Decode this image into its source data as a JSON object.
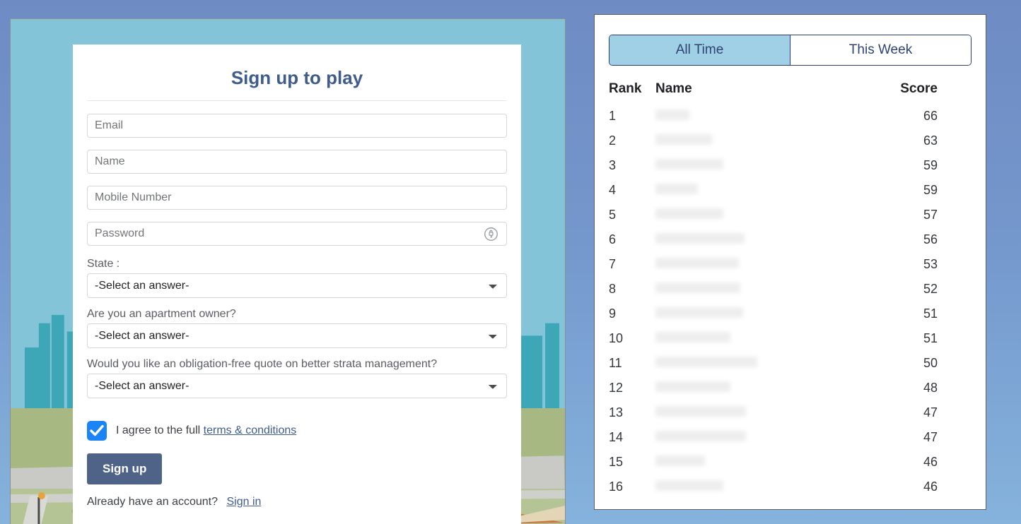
{
  "signup": {
    "title": "Sign up to play",
    "fields": [
      {
        "name": "email",
        "placeholder": "Email",
        "value": "",
        "type": "email"
      },
      {
        "name": "name",
        "placeholder": "Name",
        "value": "",
        "type": "text"
      },
      {
        "name": "mobile",
        "placeholder": "Mobile Number",
        "value": "",
        "type": "tel"
      },
      {
        "name": "password",
        "placeholder": "Password",
        "value": "",
        "type": "password"
      }
    ],
    "password_icon": "key-lock-icon",
    "questions": [
      {
        "label": "State :",
        "selected": "-Select an answer-"
      },
      {
        "label": "Are you an apartment owner?",
        "selected": "-Select an answer-"
      },
      {
        "label": "Would you like an obligation-free quote on better strata management?",
        "selected": "-Select an answer-"
      }
    ],
    "terms": {
      "checked": true,
      "text": "I agree to the full",
      "link_label": "terms & conditions"
    },
    "submit_label": "Sign up",
    "footer": {
      "text": "Already have an account?",
      "link_label": "Sign in"
    }
  },
  "leaderboard": {
    "tabs": [
      {
        "label": "All Time",
        "active": true
      },
      {
        "label": "This Week",
        "active": false
      }
    ],
    "columns": [
      "Rank",
      "Name",
      "Score"
    ],
    "rows": [
      {
        "rank": "1",
        "name": "",
        "name_width": 48,
        "score": "66"
      },
      {
        "rank": "2",
        "name": "",
        "name_width": 80,
        "score": "63"
      },
      {
        "rank": "3",
        "name": "",
        "name_width": 96,
        "score": "59"
      },
      {
        "rank": "4",
        "name": "",
        "name_width": 60,
        "score": "59"
      },
      {
        "rank": "5",
        "name": "",
        "name_width": 96,
        "score": "57"
      },
      {
        "rank": "6",
        "name": "",
        "name_width": 126,
        "score": "56"
      },
      {
        "rank": "7",
        "name": "",
        "name_width": 118,
        "score": "53"
      },
      {
        "rank": "8",
        "name": "",
        "name_width": 120,
        "score": "52"
      },
      {
        "rank": "9",
        "name": "",
        "name_width": 124,
        "score": "51"
      },
      {
        "rank": "10",
        "name": "",
        "name_width": 106,
        "score": "51"
      },
      {
        "rank": "11",
        "name": "",
        "name_width": 144,
        "score": "50"
      },
      {
        "rank": "12",
        "name": "",
        "name_width": 106,
        "score": "48"
      },
      {
        "rank": "13",
        "name": "",
        "name_width": 128,
        "score": "47"
      },
      {
        "rank": "14",
        "name": "",
        "name_width": 128,
        "score": "47"
      },
      {
        "rank": "15",
        "name": "",
        "name_width": 70,
        "score": "46"
      },
      {
        "rank": "16",
        "name": "",
        "name_width": 96,
        "score": "46"
      }
    ]
  },
  "theme": {
    "page_bg_top": "#6f8bc4",
    "page_bg_bottom": "#85b3dc",
    "title_color": "#3f5c8c",
    "button_bg": "#4f6389",
    "checkbox_bg": "#1b84f7",
    "tab_active_bg": "#9fd0e6",
    "tab_border": "#2a3a7a",
    "sky_color": "#84c4d8",
    "skyline_color": "#3da7b8",
    "ground_color": "#a8b882"
  }
}
